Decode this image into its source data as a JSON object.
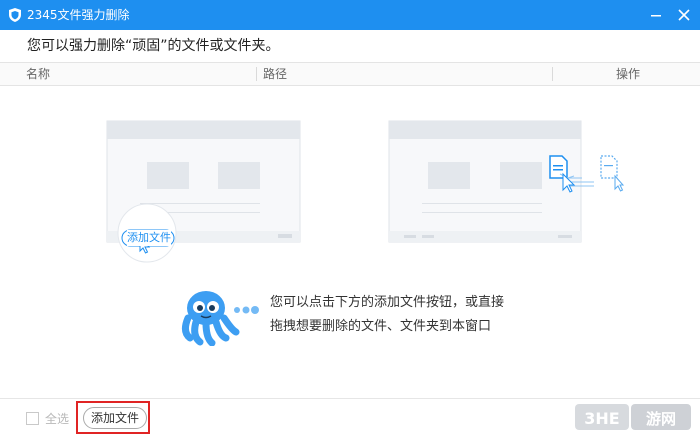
{
  "window": {
    "title": "2345文件强力删除",
    "accent": "#1e8ff0",
    "icons": {
      "app": "shield-icon",
      "minimize": "minimize-icon",
      "close": "close-icon"
    }
  },
  "subtitle": "您可以强力删除“顽固”的文件或文件夹。",
  "columns": {
    "name": "名称",
    "path": "路径",
    "action": "操作"
  },
  "illustration": {
    "add_file_label": "添加文件",
    "hint_lines": [
      "您可以点击下方的添加文件按钮，或直接",
      "拖拽想要删除的文件、文件夹到本窗口"
    ]
  },
  "footer": {
    "select_all": "全选",
    "add_button": "添加文件"
  },
  "watermark": {
    "left": "3HE",
    "right": "游网"
  }
}
